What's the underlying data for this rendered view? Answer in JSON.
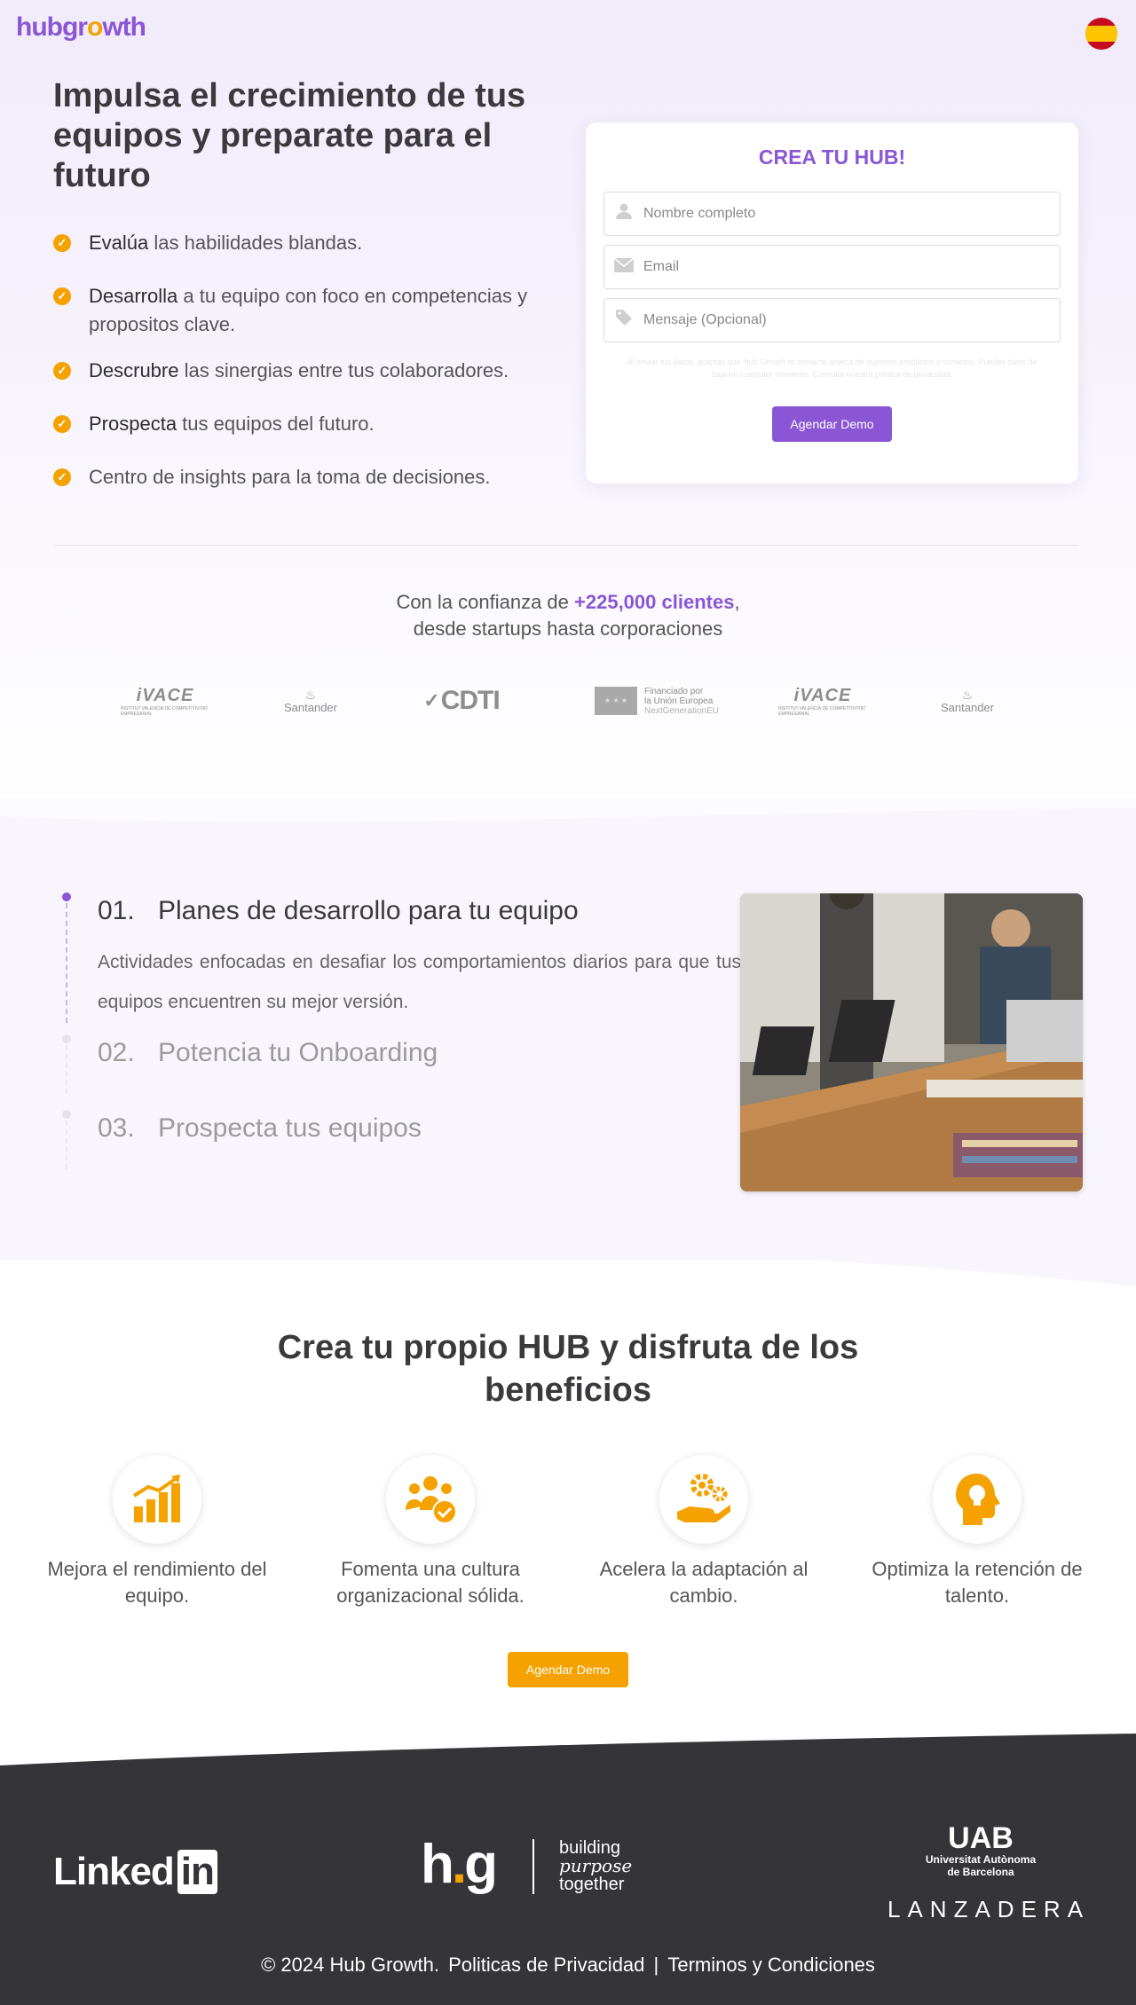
{
  "brand": {
    "logo_main": "hubgrowth",
    "accent": "#8a56d6",
    "secondary": "#f5a200"
  },
  "hero": {
    "title": "Impulsa el crecimiento de tus equipos y preparate para el futuro",
    "features": [
      {
        "strong": "Evalúa",
        "rest": " las habilidades blandas."
      },
      {
        "strong": "Desarrolla",
        "rest": " a tu equipo con foco en competencias y propositos clave."
      },
      {
        "strong": "Descrubre",
        "rest": " las sinergias entre tus colaboradores."
      },
      {
        "strong": "Prospecta",
        "rest": " tus equipos del futuro."
      },
      {
        "strong": "",
        "rest": "Centro de insights para la toma de decisiones."
      }
    ]
  },
  "form": {
    "title": "CREA TU HUB!",
    "name_placeholder": "Nombre completo",
    "email_placeholder": "Email",
    "message_placeholder": "Mensaje (Opcional)",
    "disclaimer": "Al enviar tus datos, aceptas que Hub Growth te contacte acerca de nuestros productos y servicios. Puedes darte de baja en cualquier momento. Consulta nuestra política de privacidad.",
    "submit_label": "Agendar Demo"
  },
  "trust": {
    "prefix": "Con la confianza de ",
    "highlight": "+225,000 clientes",
    "suffix": ",",
    "line2": "desde startups hasta corporaciones"
  },
  "partners": {
    "ivace": "iVACE",
    "ivace_sub": "INSTITUT VALENCIÀ DE COMPETITIVITAT EMPRESARIAL",
    "santander": "Santander",
    "cdti": "CDTI",
    "eu_line1": "Financiado por",
    "eu_line2": "la Unión Europea",
    "eu_line3": "NextGenerationEU"
  },
  "steps": [
    {
      "num": "01.",
      "title": "Planes de desarrollo para tu equipo",
      "desc": "Actividades enfocadas en desafiar los comportamientos diarios para que tus equipos encuentren su mejor versión."
    },
    {
      "num": "02.",
      "title": "Potencia tu Onboarding"
    },
    {
      "num": "03.",
      "title": "Prospecta tus equipos"
    }
  ],
  "benefits": {
    "title": "Crea tu propio HUB y disfruta de los beneficios",
    "items": [
      {
        "icon": "chart-growth-icon",
        "label": "Mejora el rendimiento del equipo."
      },
      {
        "icon": "team-check-icon",
        "label": "Fomenta una cultura organizacional sólida."
      },
      {
        "icon": "gears-hand-icon",
        "label": "Acelera la adaptación al cambio."
      },
      {
        "icon": "head-bulb-icon",
        "label": "Optimiza la retención de talento."
      }
    ],
    "cta_label": "Agendar  Demo"
  },
  "footer": {
    "linkedin": "Linked",
    "linkedin_in": "in",
    "hg": "h",
    "hg_g": "g",
    "tag1": "building",
    "tag2": "purpose",
    "tag3": "together",
    "uab": "UAB",
    "uab_sub1": "Universitat Autònoma",
    "uab_sub2": "de Barcelona",
    "lanzadera": "LANZADERA",
    "copyright": "© 2024 Hub Growth.",
    "privacy": "Politicas de Privacidad",
    "sep": "|",
    "terms": "Terminos y Condiciones"
  }
}
